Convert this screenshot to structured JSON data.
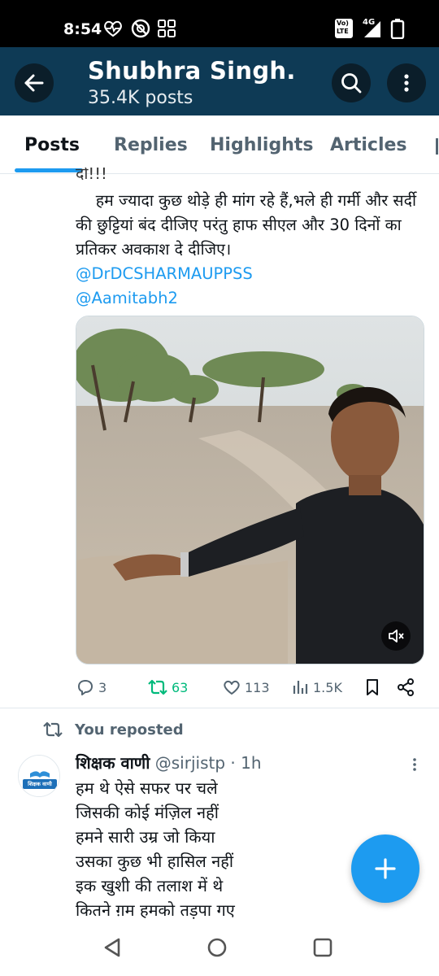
{
  "status_bar": {
    "time": "8:54",
    "network": "4G",
    "network_badge_top": "Vo)",
    "network_badge_bottom": "LTE"
  },
  "header": {
    "title": "Shubhra Singh.",
    "subtitle": "35.4K posts",
    "icons": [
      "back-arrow-icon",
      "search-icon",
      "more-vertical-icon"
    ]
  },
  "tabs": [
    {
      "label": "Posts",
      "active": true
    },
    {
      "label": "Replies",
      "active": false
    },
    {
      "label": "Highlights",
      "active": false
    },
    {
      "label": "Articles",
      "active": false
    }
  ],
  "tweet1": {
    "cut_line": "दो!!!",
    "text": "    हम ज्यादा कुछ थोड़े ही मांग रहे हैं,भले ही गर्मी और सर्दी की छुट्टियां बंद दीजिए परंतु हाफ सीएल और 30 दिनों का प्रतिकर अवकाश दे दीजिए।",
    "mentions": [
      "@DrDCSHARMAUPPSS",
      "@Aamitabh2"
    ],
    "media": {
      "kind": "video",
      "muted": true
    },
    "stats": {
      "replies": "3",
      "reposts": "63",
      "likes": "113",
      "views": "1.5K"
    }
  },
  "tweet2": {
    "repost_label": "You reposted",
    "avatar_text": "शिक्षक वाणी",
    "display_name": "शिक्षक वाणी",
    "handle": "@sirjistp",
    "sep": "·",
    "time": "1h",
    "lines": [
      "हम थे ऐसे सफर पर चले",
      "जिसकी कोई मंज़िल नहीं",
      "हमने सारी उम्र जो किया",
      "उसका कुछ भी हासिल नहीं",
      "इक खुशी की तलाश में थे",
      "कितने ग़म हमको तड़पा गए"
    ]
  },
  "fab": {
    "icon": "plus-icon"
  },
  "colors": {
    "header_bg": "#0e3a55",
    "accent": "#1d9bf0",
    "repost_green": "#00ba7c",
    "muted_text": "#536471"
  }
}
